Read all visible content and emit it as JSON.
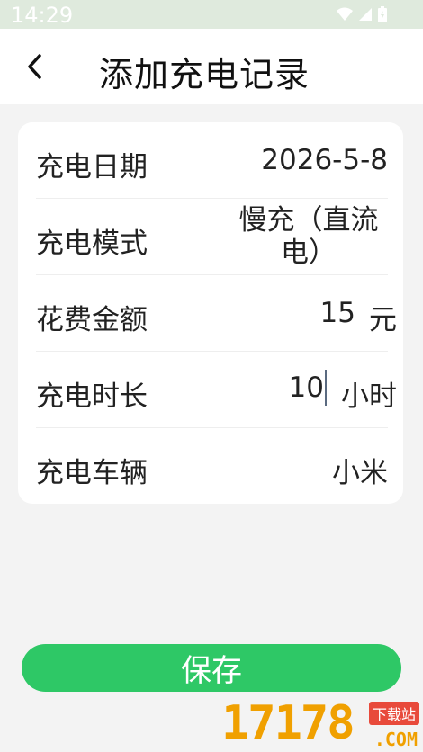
{
  "status_bar": {
    "time": "14:29"
  },
  "header": {
    "title": "添加充电记录"
  },
  "form": {
    "date": {
      "label": "充电日期",
      "value": "2026-5-8"
    },
    "mode": {
      "label": "充电模式",
      "value_line1": "慢充（直流",
      "value_line2": "电）"
    },
    "cost": {
      "label": "花费金额",
      "value": "15",
      "unit": "元"
    },
    "duration": {
      "label": "充电时长",
      "value": "10",
      "unit": "小时"
    },
    "vehicle": {
      "label": "充电车辆",
      "value": "小米"
    }
  },
  "save_button": {
    "label": "保存"
  },
  "watermark": {
    "number": "17178",
    "tag": "下载站",
    "domain": ".COM"
  },
  "colors": {
    "accent": "#2ec866",
    "status_bar": "#dfeadd",
    "background": "#f3f3f3"
  }
}
